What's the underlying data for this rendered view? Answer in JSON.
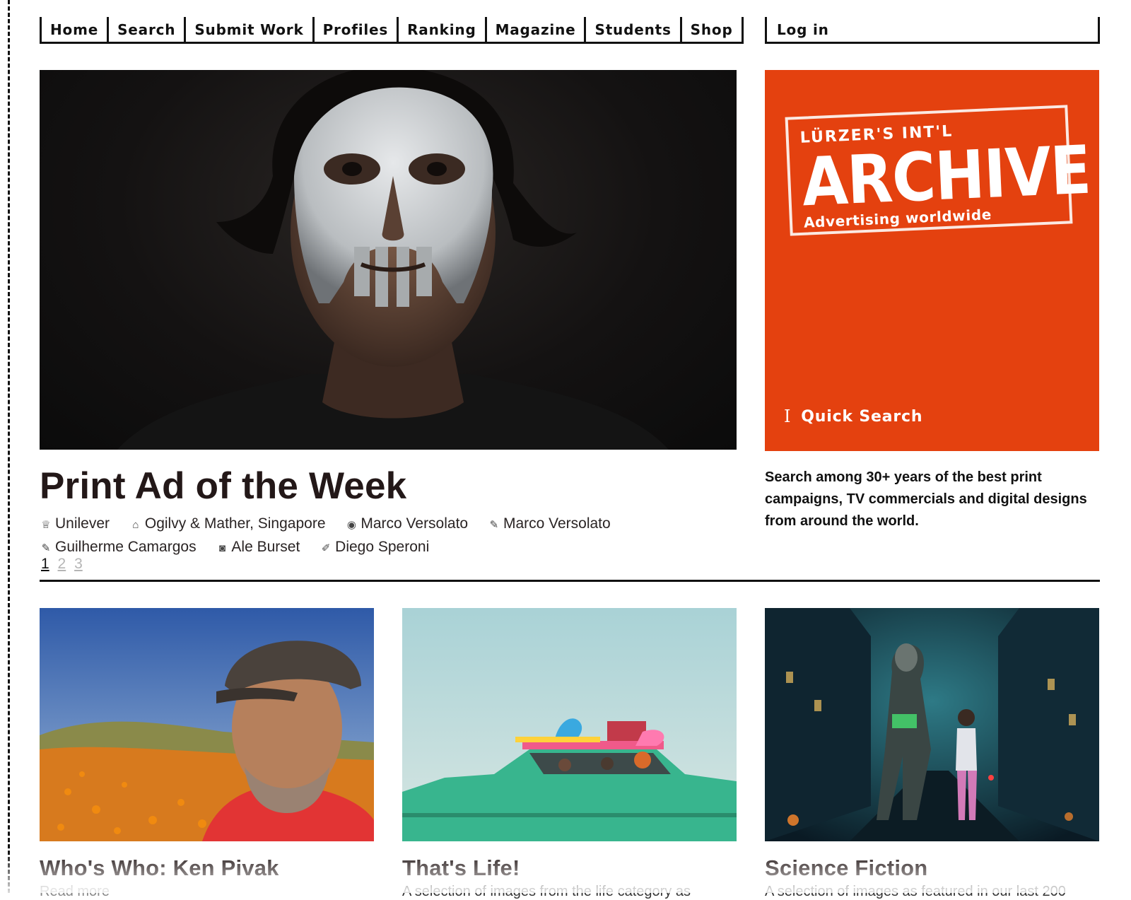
{
  "nav": {
    "items": [
      "Home",
      "Search",
      "Submit Work",
      "Profiles",
      "Ranking",
      "Magazine",
      "Students",
      "Shop"
    ],
    "login": "Log in"
  },
  "feature": {
    "title": "Print Ad of the Week",
    "credits": [
      {
        "icon": "crown-icon",
        "glyph": "♕",
        "text": "Unilever"
      },
      {
        "icon": "agency-icon",
        "glyph": "⌂",
        "text": "Ogilvy & Mather, Singapore"
      },
      {
        "icon": "eye-icon",
        "glyph": "◉",
        "text": "Marco Versolato"
      },
      {
        "icon": "pen-icon",
        "glyph": "✎",
        "text": "Marco Versolato"
      },
      {
        "icon": "pen-icon",
        "glyph": "✎",
        "text": "Guilherme Camargos"
      },
      {
        "icon": "camera-icon",
        "glyph": "◙",
        "text": "Ale Burset"
      },
      {
        "icon": "brush-icon",
        "glyph": "✐",
        "text": "Diego Speroni"
      }
    ],
    "pages": [
      "1",
      "2",
      "3"
    ],
    "active_page": "1"
  },
  "archive": {
    "logo_small": "LÜRZER'S  INT'L",
    "logo_big": "ARCHIVE",
    "logo_tagline": "Advertising worldwide",
    "quick_search": "Quick Search",
    "description": "Search among 30+ years of the best print campaigns, TV commercials and digital designs from around the world.",
    "accent": "#e4410f"
  },
  "cards": [
    {
      "title": "Who's Who: Ken Pivak",
      "text": "Read more"
    },
    {
      "title": "That's Life!",
      "text": "A selection of images from the life category as"
    },
    {
      "title": "Science Fiction",
      "text": "A selection of images as featured in our last 200"
    }
  ]
}
